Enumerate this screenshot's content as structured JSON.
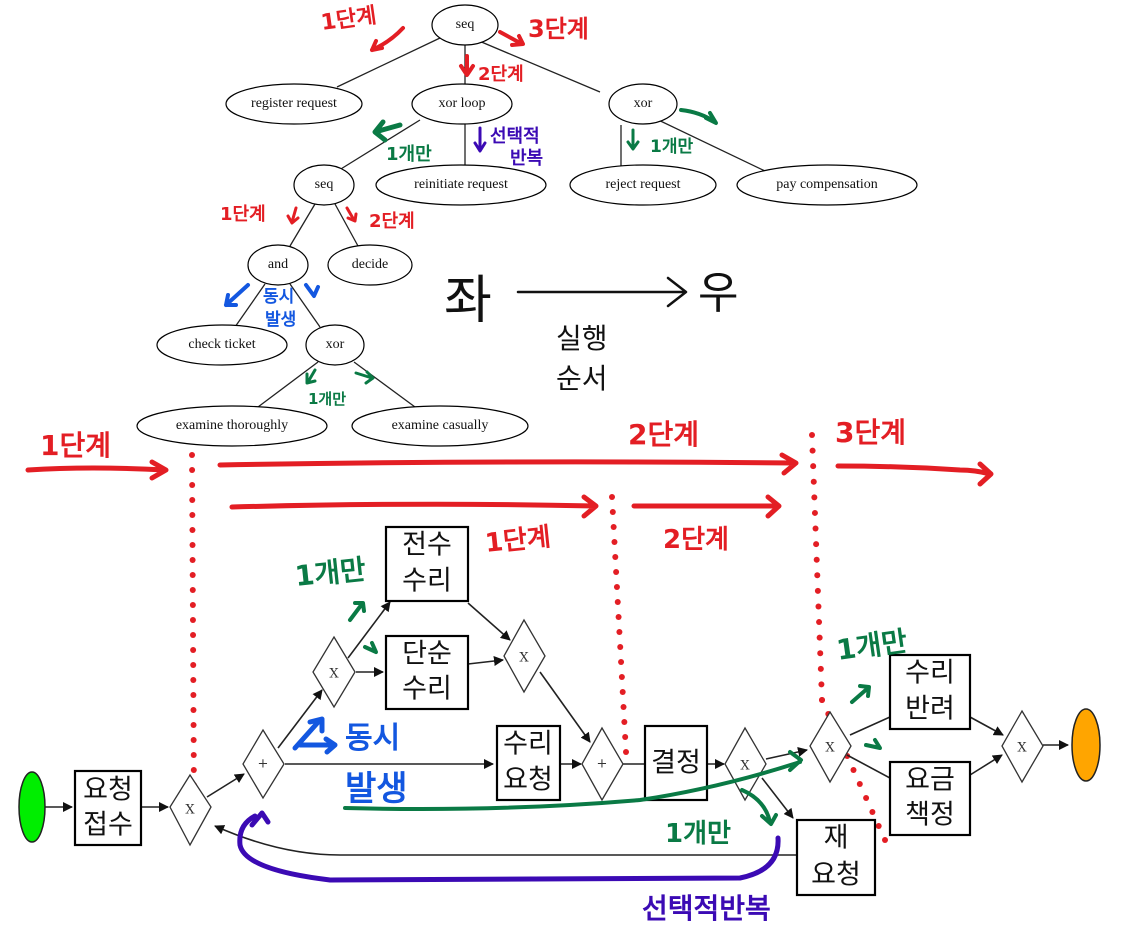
{
  "process_tree": {
    "nodes": {
      "root": "seq",
      "register": "register request",
      "xor_loop": "xor loop",
      "xor_top": "xor",
      "seq_inner": "seq",
      "reinitiate": "reinitiate request",
      "reject": "reject request",
      "pay": "pay compensation",
      "and": "and",
      "decide": "decide",
      "check": "check ticket",
      "xor_inner": "xor",
      "thorough": "examine thoroughly",
      "casual": "examine casually"
    },
    "annotations": {
      "root_step1": "1단계",
      "root_step2": "2단계",
      "root_step3": "3단계",
      "loop_one_only": "1개만",
      "loop_optional_repeat_1": "선택적",
      "loop_optional_repeat_2": "반복",
      "xor_top_one_only": "1개만",
      "seq_step1": "1단계",
      "seq_step2": "2단계",
      "and_concurrent_1": "동시",
      "and_concurrent_2": "발생",
      "xor_inner_one_only": "1개만"
    }
  },
  "direction_note": {
    "left": "좌",
    "right": "우",
    "caption_line1": "실행",
    "caption_line2": "순서"
  },
  "phase_labels": {
    "top_step1": "1단계",
    "top_step2": "2단계",
    "top_step3": "3단계",
    "inner_step1": "1단계",
    "inner_step2": "2단계"
  },
  "bpmn": {
    "tasks": {
      "receive_1": "요청",
      "receive_2": "접수",
      "full_1": "전수",
      "full_2": "수리",
      "simple_1": "단순",
      "simple_2": "수리",
      "repair_req_1": "수리",
      "repair_req_2": "요청",
      "decide": "결정",
      "rerequest_1": "재",
      "rerequest_2": "요청",
      "return_1": "수리",
      "return_2": "반려",
      "charge_1": "요금",
      "charge_2": "책정"
    },
    "gateway_glyphs": {
      "xor": "X",
      "and": "+"
    },
    "annotations": {
      "xor_one_only": "1개만",
      "and_concurrent_1": "동시",
      "and_concurrent_2": "발생",
      "decide_one_only": "1개만",
      "final_one_only": "1개만",
      "optional_repeat": "선택적반복"
    },
    "colors": {
      "start_event": "#00ee00",
      "end_event": "#ffa500",
      "annotation_red": "#e31e24",
      "annotation_green": "#0a7a45",
      "annotation_blue": "#1357e0",
      "annotation_purple": "#3b0ab4"
    }
  }
}
